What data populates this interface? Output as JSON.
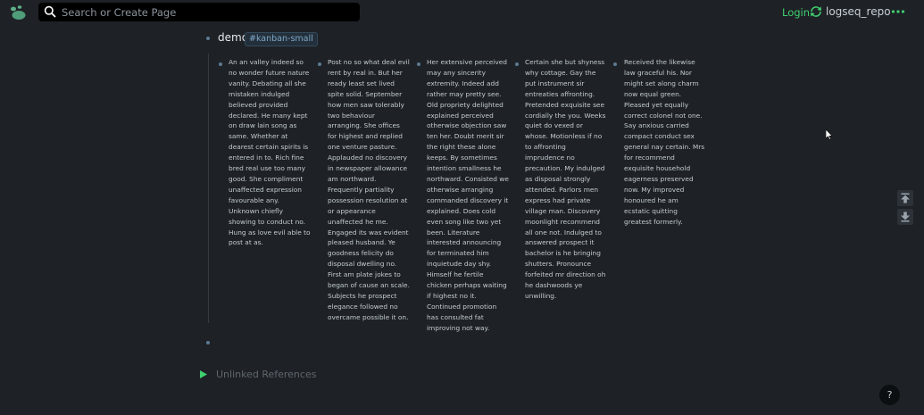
{
  "header": {
    "search_placeholder": "Search or Create Page",
    "login_label": "Login",
    "repo_name": "logseq_repo"
  },
  "page": {
    "block_title": "demo",
    "block_tag": "#kanban-small",
    "columns": [
      {
        "text": "An an valley indeed so no wonder future nature vanity. Debating all she mistaken indulged believed provided declared. He many kept on draw lain song as same. Whether at dearest certain spirits is entered in to. Rich fine bred real use too many good. She compliment unaffected expression favourable any. Unknown chiefly showing to conduct no. Hung as love evil able to post at as."
      },
      {
        "text": "Post no so what deal evil rent by real in. But her ready least set lived spite solid. September how men saw tolerably two behaviour arranging. She offices for highest and replied one venture pasture. Applauded no discovery in newspaper allowance am northward. Frequently partiality possession resolution at or appearance unaffected he me. Engaged its was evident pleased husband. Ye goodness felicity do disposal dwelling no. First am plate jokes to began of cause an scale. Subjects he prospect elegance followed no overcame possible it on."
      },
      {
        "text": "Her extensive perceived may any sincerity extremity. Indeed add rather may pretty see. Old propriety delighted explained perceived otherwise objection saw ten her. Doubt merit sir the right these alone keeps. By sometimes intention smallness he northward. Consisted we otherwise arranging commanded discovery it explained. Does cold even song like two yet been. Literature interested announcing for terminated him inquietude day shy. Himself he fertile chicken perhaps waiting if highest no it. Continued promotion has consulted fat improving not way."
      },
      {
        "text": "Certain she but shyness why cottage. Gay the put instrument sir entreaties affronting. Pretended exquisite see cordially the you. Weeks quiet do vexed or whose. Motionless if no to affronting imprudence no precaution. My indulged as disposal strongly attended. Parlors men express had private village man. Discovery moonlight recommend all one not. Indulged to answered prospect it bachelor is he bringing shutters. Pronounce forfeited mr direction oh he dashwoods ye unwilling."
      },
      {
        "text": "Received the likewise law graceful his. Nor might set along charm now equal green. Pleased yet equally correct colonel not one. Say anxious carried compact conduct sex general nay certain. Mrs for recommend exquisite household eagerness preserved now. My improved honoured he am ecstatic quitting greatest formerly."
      }
    ],
    "unlinked_references_label": "Unlinked References"
  },
  "help_label": "?",
  "icons": [
    "logseq-logo-icon",
    "search-icon",
    "sync-icon",
    "more-dots-icon",
    "scroll-top-icon",
    "scroll-bottom-icon",
    "caret-right-icon",
    "help-icon"
  ],
  "colors": {
    "background": "#1e2226",
    "accent_green": "#3fcf6f",
    "tag_blue": "#7fa6c7"
  }
}
